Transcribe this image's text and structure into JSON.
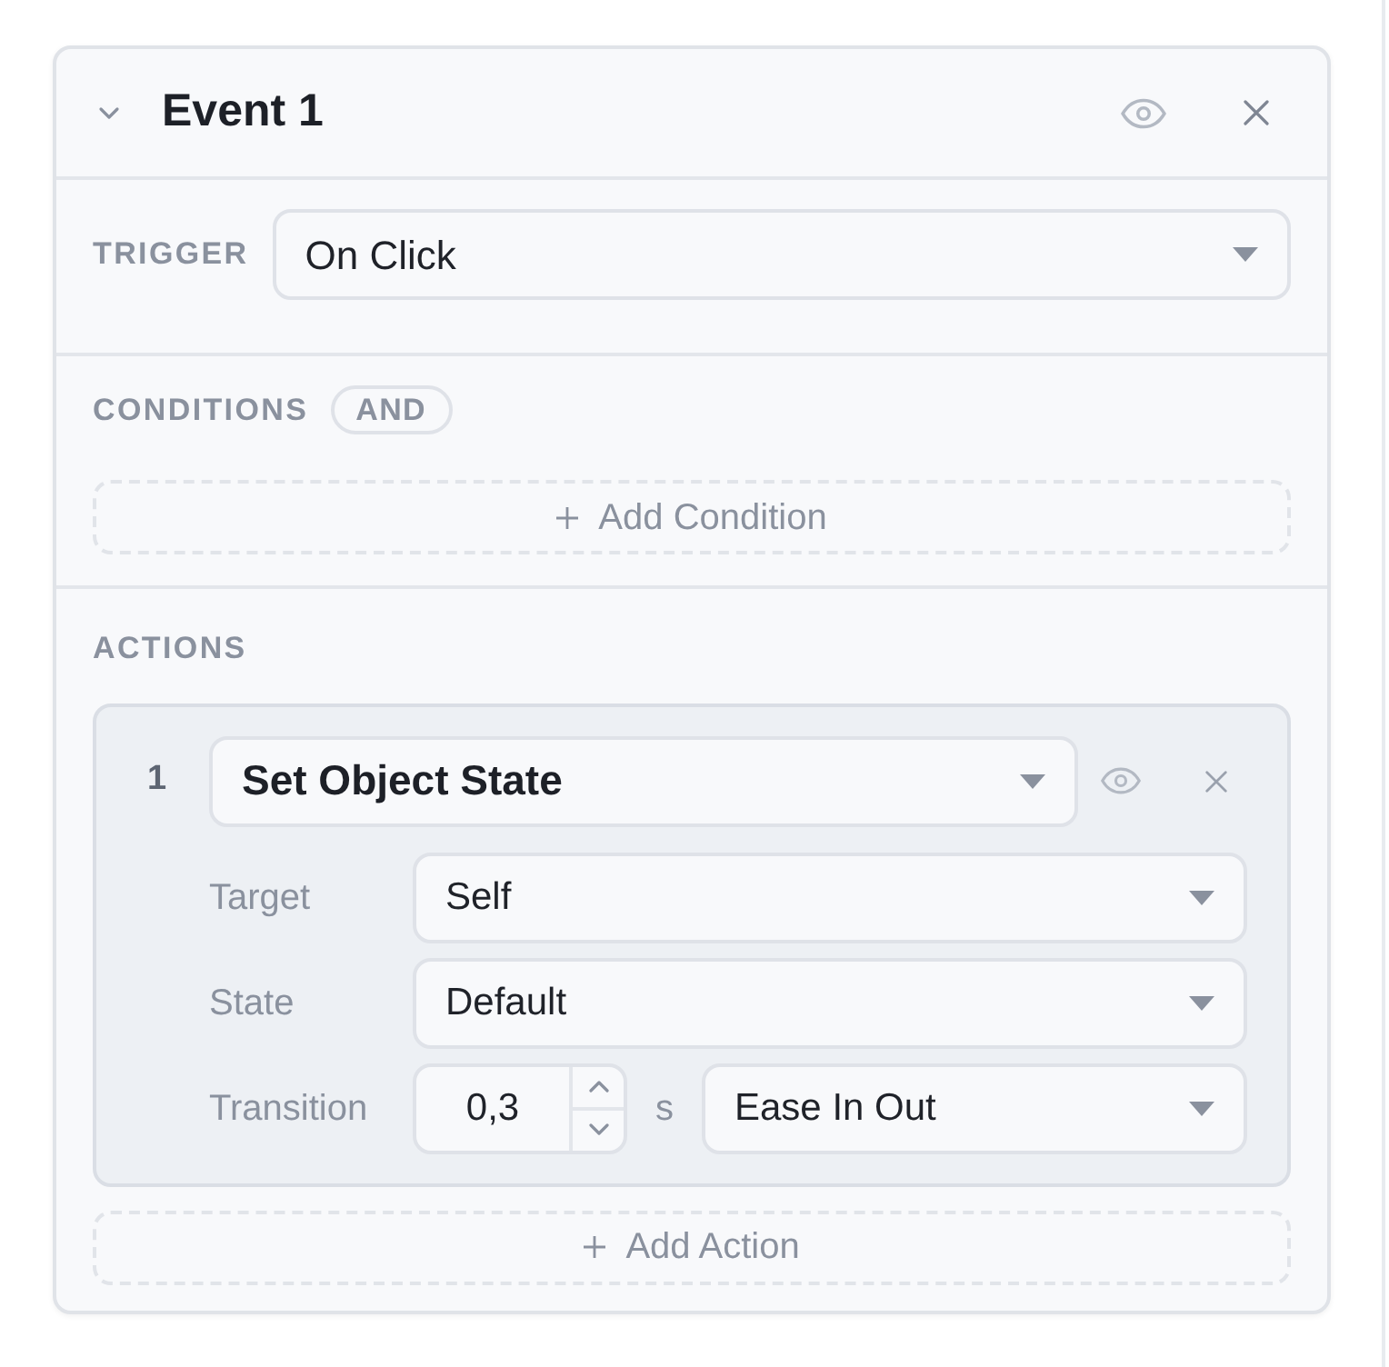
{
  "event": {
    "title": "Event 1",
    "expanded": true
  },
  "trigger": {
    "label": "TRIGGER",
    "value": "On Click"
  },
  "conditions": {
    "label": "CONDITIONS",
    "operator": "AND",
    "add_button": "Add Condition"
  },
  "actions": {
    "label": "ACTIONS",
    "items": [
      {
        "number": "1",
        "type": "Set Object State",
        "fields": [
          {
            "kind": "select",
            "label": "Target",
            "value": "Self"
          },
          {
            "kind": "select",
            "label": "State",
            "value": "Default"
          },
          {
            "kind": "transition",
            "label": "Transition",
            "value": "0,3",
            "unit": "s",
            "easing": "Ease In Out"
          }
        ]
      }
    ],
    "add_button": "Add Action"
  }
}
